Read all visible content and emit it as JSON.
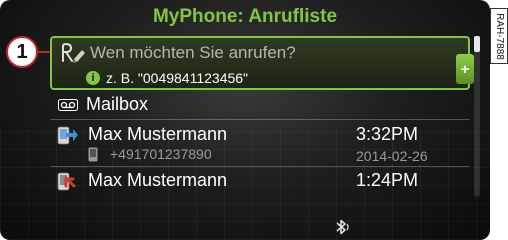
{
  "header": {
    "title": "MyPhone: Anrufliste"
  },
  "figure_tag": "RAH-7888",
  "callout": {
    "number": "1"
  },
  "search": {
    "placeholder": "Wen möchten Sie anrufen?",
    "example": "z. B. \"0049841123456\"",
    "add_label": "+"
  },
  "list": {
    "mailbox_label": "Mailbox",
    "calls": [
      {
        "name": "Max Mustermann",
        "time": "3:32PM",
        "number": "+491701237890",
        "date": "2014-02-26",
        "type": "outgoing"
      },
      {
        "name": "Max Mustermann",
        "time": "1:24PM",
        "type": "missed"
      }
    ]
  },
  "colors": {
    "accent": "#86c540",
    "callout": "#c3262e",
    "missed": "#d33a2c",
    "outgoing": "#3b8fd9"
  },
  "icons": {
    "search": "handwriting-icon",
    "info": "info-icon",
    "mailbox": "voicemail-icon",
    "outgoing": "outgoing-call-icon",
    "missed": "missed-call-icon",
    "phone": "mobile-phone-icon",
    "status": "bluetooth-icon"
  }
}
